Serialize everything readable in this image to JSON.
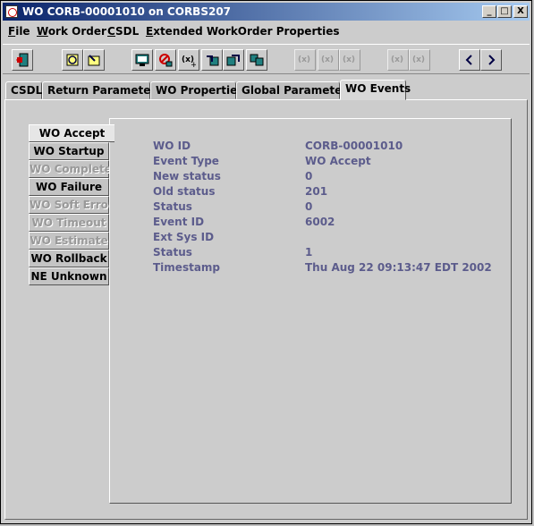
{
  "window": {
    "title": "WO CORB-00001010 on CORBS207",
    "controls": {
      "minimize": "_",
      "maximize": "□",
      "close": "X"
    }
  },
  "menu": {
    "file": {
      "hot": "F",
      "rest": "ile"
    },
    "work_order": {
      "hot": "W",
      "rest": "ork Order"
    },
    "csdl": {
      "hot": "C",
      "rest": "SDL"
    },
    "extended": {
      "hot": "E",
      "rest": "xtended WorkOrder Properties"
    }
  },
  "toolbar": {
    "icons": [
      "exit-icon",
      "refresh-icon",
      "edit-icon",
      "view-icon",
      "stop-icon",
      "add-variable-icon",
      "import-icon",
      "export-icon",
      "transfer-icon",
      "variable-plus-icon",
      "variable-check-icon",
      "variable-minus-icon",
      "variable-add-icon",
      "variable-delete-icon",
      "previous-icon",
      "next-icon"
    ],
    "var_label": "(x)"
  },
  "tabs": [
    "CSDL",
    "Return Parameters",
    "WO Properties",
    "Global Parameters",
    "WO Events"
  ],
  "active_tab": "WO Events",
  "event_tabs": [
    {
      "label": "WO Accept",
      "enabled": true,
      "active": true
    },
    {
      "label": "WO Startup",
      "enabled": true
    },
    {
      "label": "WO Complete",
      "enabled": false
    },
    {
      "label": "WO Failure",
      "enabled": true
    },
    {
      "label": "WO Soft Error",
      "enabled": false
    },
    {
      "label": "WO Timeout",
      "enabled": false
    },
    {
      "label": "WO Estimate",
      "enabled": false
    },
    {
      "label": "WO Rollback",
      "enabled": true
    },
    {
      "label": "NE Unknown",
      "enabled": true
    }
  ],
  "details": [
    {
      "label": "WO ID",
      "value": "CORB-00001010"
    },
    {
      "label": "Event Type",
      "value": "WO Accept"
    },
    {
      "label": "New status",
      "value": "0"
    },
    {
      "label": "Old status",
      "value": "201"
    },
    {
      "label": "Status",
      "value": "0"
    },
    {
      "label": "Event ID",
      "value": "6002"
    },
    {
      "label": "Ext Sys ID",
      "value": ""
    },
    {
      "label": "Status",
      "value": "1"
    },
    {
      "label": "Timestamp",
      "value": "Thu Aug 22 09:13:47 EDT 2002"
    }
  ]
}
